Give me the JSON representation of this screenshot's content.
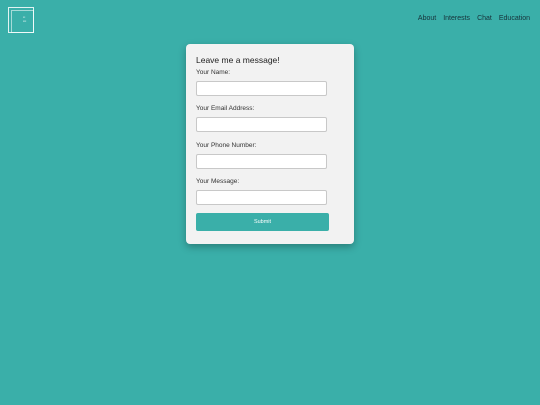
{
  "nav": {
    "items": [
      {
        "label": "About"
      },
      {
        "label": "Interests"
      },
      {
        "label": "Chat"
      },
      {
        "label": "Education"
      }
    ]
  },
  "form": {
    "title": "Leave me a message!",
    "name_label": "Your Name:",
    "email_label": "Your Email Address:",
    "phone_label": "Your Phone Number:",
    "message_label": "Your Message:",
    "submit_label": "Submit"
  },
  "colors": {
    "background": "#3aafa9",
    "card": "#f2f2f2",
    "button": "#3aafa9"
  }
}
